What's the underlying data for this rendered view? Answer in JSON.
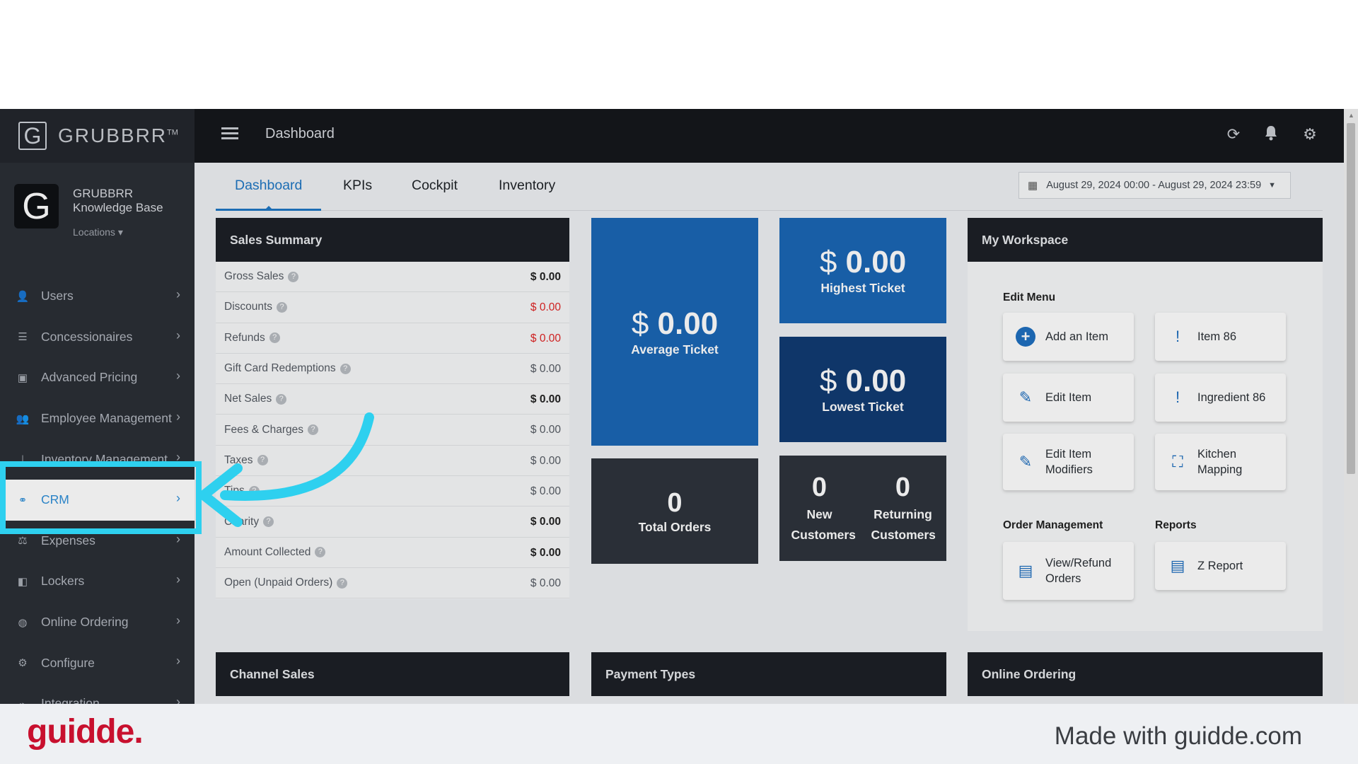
{
  "app": {
    "brand_name": "GRUBBRR",
    "brand_tm": "TM",
    "brand_letter": "G",
    "title": "Dashboard",
    "top_icons": [
      "refresh-icon",
      "bell-icon",
      "gear-icon"
    ]
  },
  "sidebar": {
    "org_letter": "G",
    "org_name": "GRUBBRR Knowledge Base",
    "locations_label": "Locations ▾",
    "items": [
      {
        "label": "Users",
        "icon": "users-icon"
      },
      {
        "label": "Concessionaires",
        "icon": "list-icon"
      },
      {
        "label": "Advanced Pricing",
        "icon": "money-icon"
      },
      {
        "label": "Employee Management",
        "icon": "group-icon"
      },
      {
        "label": "Inventory Management",
        "icon": "hierarchy-icon"
      },
      {
        "label": "CRM",
        "icon": "link-icon",
        "active": true
      },
      {
        "label": "Expenses",
        "icon": "scale-icon"
      },
      {
        "label": "Lockers",
        "icon": "locker-icon"
      },
      {
        "label": "Online Ordering",
        "icon": "globe-icon"
      },
      {
        "label": "Configure",
        "icon": "gear-icon"
      },
      {
        "label": "Integration",
        "icon": "plug-icon"
      }
    ]
  },
  "tabs": [
    {
      "label": "Dashboard",
      "active": true
    },
    {
      "label": "KPIs"
    },
    {
      "label": "Cockpit"
    },
    {
      "label": "Inventory"
    }
  ],
  "date_range": "August 29, 2024 00:00 - August 29, 2024 23:59",
  "sales_summary": {
    "title": "Sales Summary",
    "rows": [
      {
        "label": "Gross Sales",
        "value": "$ 0.00",
        "style": "bold"
      },
      {
        "label": "Discounts",
        "value": "$ 0.00",
        "style": "red"
      },
      {
        "label": "Refunds",
        "value": "$ 0.00",
        "style": "red"
      },
      {
        "label": "Gift Card Redemptions",
        "value": "$ 0.00",
        "style": "normal"
      },
      {
        "label": "Net Sales",
        "value": "$ 0.00",
        "style": "bold"
      },
      {
        "label": "Fees & Charges",
        "value": "$ 0.00",
        "style": "normal"
      },
      {
        "label": "Taxes",
        "value": "$ 0.00",
        "style": "normal"
      },
      {
        "label": "Tips",
        "value": "$ 0.00",
        "style": "normal"
      },
      {
        "label": "Charity",
        "value": "$ 0.00",
        "style": "bold"
      },
      {
        "label": "Amount Collected",
        "value": "$ 0.00",
        "style": "bold"
      },
      {
        "label": "Open (Unpaid Orders)",
        "value": "$ 0.00",
        "style": "normal"
      }
    ]
  },
  "tiles": {
    "average": {
      "currency": "$",
      "amount": "0.00",
      "label": "Average Ticket"
    },
    "highest": {
      "currency": "$",
      "amount": "0.00",
      "label": "Highest Ticket"
    },
    "lowest": {
      "currency": "$",
      "amount": "0.00",
      "label": "Lowest Ticket"
    },
    "total_orders": {
      "count": "0",
      "label": "Total Orders"
    },
    "new_customers": {
      "count": "0",
      "label": "New Customers"
    },
    "returning_customers": {
      "count": "0",
      "label": "Returning Customers"
    }
  },
  "workspace": {
    "title": "My Workspace",
    "edit_menu_label": "Edit Menu",
    "order_mgmt_label": "Order Management",
    "reports_label": "Reports",
    "buttons": {
      "add_item": "Add an Item",
      "item86": "Item 86",
      "edit_item": "Edit Item",
      "ingredient86": "Ingredient 86",
      "edit_modifiers": "Edit Item Modifiers",
      "kitchen_mapping": "Kitchen Mapping",
      "view_refund": "View/Refund Orders",
      "z_report": "Z Report"
    }
  },
  "bottom_panels": {
    "channel_sales": "Channel Sales",
    "payment_types": "Payment Types",
    "online_ordering": "Online Ordering"
  },
  "footer": {
    "logo": "guidde.",
    "made_with": "Made with guidde.com"
  },
  "colors": {
    "accent_blue": "#1b66b5",
    "navy": "#113b72",
    "highlight_cyan": "#2ed0ef",
    "guidde_red": "#c8102e"
  }
}
